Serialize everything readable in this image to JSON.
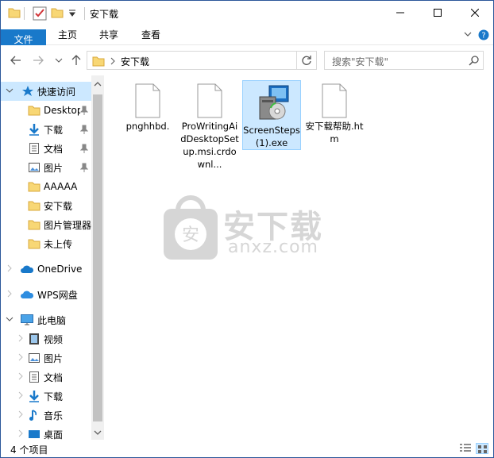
{
  "window": {
    "title": "安下载"
  },
  "ribbon": {
    "tabs": [
      "文件",
      "主页",
      "共享",
      "查看"
    ]
  },
  "address": {
    "path": "安下载",
    "search_placeholder": "搜索\"安下载\""
  },
  "sidebar": {
    "items": [
      {
        "label": "快速访问",
        "icon": "star-icon"
      },
      {
        "label": "Desktop",
        "icon": "folder-icon"
      },
      {
        "label": "下载",
        "icon": "download-icon"
      },
      {
        "label": "文档",
        "icon": "document-icon"
      },
      {
        "label": "图片",
        "icon": "picture-icon"
      },
      {
        "label": "AAAAA",
        "icon": "folder-icon"
      },
      {
        "label": "安下载",
        "icon": "folder-icon"
      },
      {
        "label": "图片管理器",
        "icon": "folder-icon"
      },
      {
        "label": "未上传",
        "icon": "folder-icon"
      },
      {
        "label": "OneDrive",
        "icon": "cloud-icon"
      },
      {
        "label": "WPS网盘",
        "icon": "cloud-icon"
      },
      {
        "label": "此电脑",
        "icon": "computer-icon"
      },
      {
        "label": "视频",
        "icon": "video-icon"
      },
      {
        "label": "图片",
        "icon": "picture-icon"
      },
      {
        "label": "文档",
        "icon": "document-icon"
      },
      {
        "label": "下载",
        "icon": "download-icon"
      },
      {
        "label": "音乐",
        "icon": "music-icon"
      },
      {
        "label": "桌面",
        "icon": "desktop-icon"
      }
    ]
  },
  "files": [
    {
      "name": "pnghhbd.",
      "icon": "blank-file-icon"
    },
    {
      "name": "ProWritingAidDesktopSetup.msi.crdownl...",
      "icon": "blank-file-icon"
    },
    {
      "name": "ScreenSteps (1).exe",
      "icon": "installer-icon"
    },
    {
      "name": "安下载帮助.htm",
      "icon": "blank-file-icon"
    }
  ],
  "watermark": {
    "cn": "安下载",
    "en": "anxz.com",
    "badge": "安"
  },
  "status": {
    "count": "4 个项目"
  },
  "colors": {
    "accent": "#1979ca",
    "selection": "#cce8ff",
    "folder": "#f8d775"
  }
}
